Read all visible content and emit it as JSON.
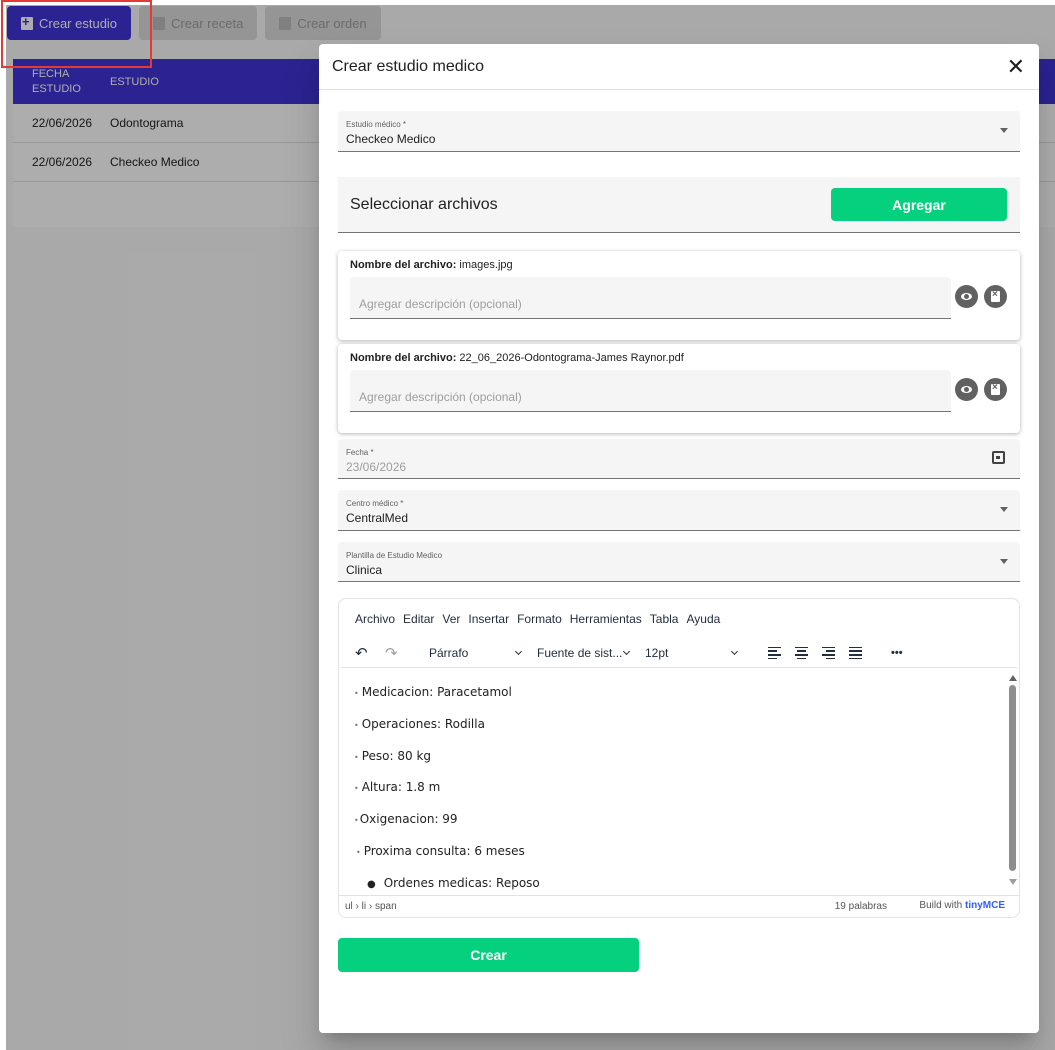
{
  "toolbar": {
    "create_study": "Crear estudio",
    "create_recipe": "Crear receta",
    "create_order": "Crear orden"
  },
  "table": {
    "headers": [
      "FECHA ESTUDIO",
      "ESTUDIO"
    ],
    "rows": [
      {
        "date": "22/06/2026",
        "study": "Odontograma"
      },
      {
        "date": "22/06/2026",
        "study": "Checkeo Medico"
      }
    ]
  },
  "dialog": {
    "title": "Crear estudio medico",
    "study_field": {
      "label": "Estudio médico *",
      "value": "Checkeo Medico"
    },
    "files_section": {
      "title": "Seleccionar archivos",
      "add_label": "Agregar"
    },
    "files": [
      {
        "name_label": "Nombre del archivo:",
        "name": "images.jpg",
        "desc_placeholder": "Agregar descripción (opcional)"
      },
      {
        "name_label": "Nombre del archivo:",
        "name": "22_06_2026-Odontograma-James Raynor.pdf",
        "desc_placeholder": "Agregar descripción (opcional)"
      }
    ],
    "date_field": {
      "label": "Fecha *",
      "value": "23/06/2026"
    },
    "center_field": {
      "label": "Centro médico *",
      "value": "CentralMed"
    },
    "template_field": {
      "label": "Plantilla de Estudio Medico",
      "value": "Clinica"
    },
    "create_label": "Crear"
  },
  "editor": {
    "menus": [
      "Archivo",
      "Editar",
      "Ver",
      "Insertar",
      "Formato",
      "Herramientas",
      "Tabla",
      "Ayuda"
    ],
    "block_format": "Párrafo",
    "font_family": "Fuente de sist...",
    "font_size": "12pt",
    "more": "•••",
    "lines": [
      "Medicacion: Paracetamol",
      "Operaciones: Rodilla",
      "Peso: 80 kg",
      "Altura: 1.8 m",
      "Oxigenacion: 99",
      "Proxima consulta: 6 meses",
      "Ordenes medicas: Reposo"
    ],
    "path": "ul › li › span",
    "word_count": "19 palabras",
    "brand_prefix": "Build with",
    "brand_name": "tinyMCE"
  },
  "colors": {
    "primary": "#3f34d6",
    "success": "#05d07d",
    "highlight": "#e53935"
  }
}
